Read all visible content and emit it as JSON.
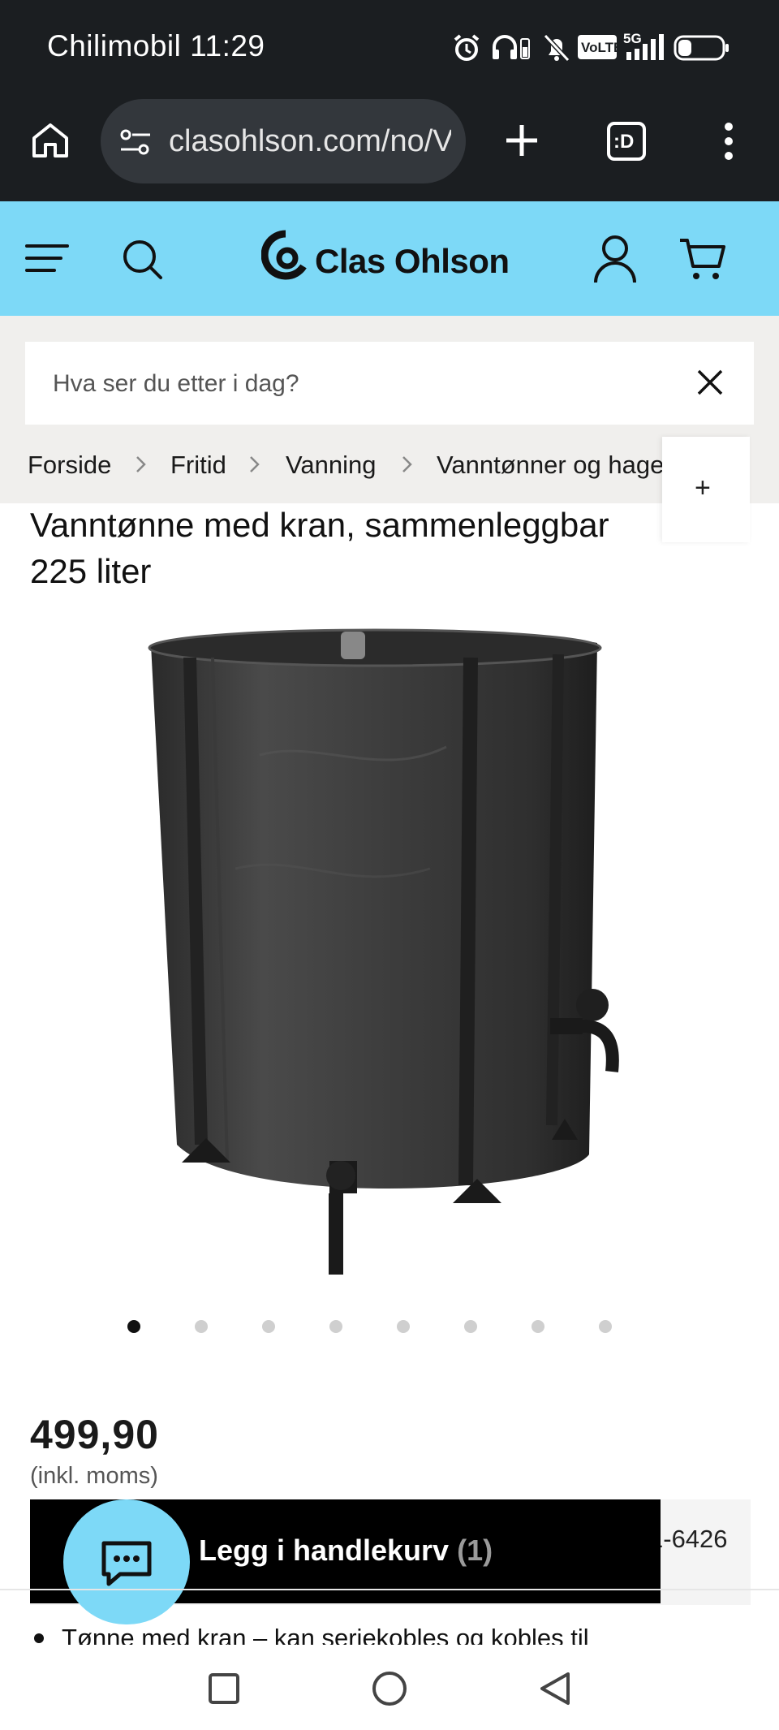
{
  "status_bar": {
    "carrier_time": "Chilimobil 11:29",
    "icons": [
      "alarm-icon",
      "headphones-icon",
      "vibrate-off-icon",
      "volte-badge",
      "signal-5g-icon",
      "battery-icon"
    ],
    "volte": "VoLTE",
    "network": "5G"
  },
  "browser": {
    "url": "clasohlson.com/no/V",
    "tab_count_label": ":D",
    "icons": [
      "home-icon",
      "site-settings-icon",
      "new-tab-plus-icon",
      "tab-switcher-icon",
      "more-menu-icon"
    ]
  },
  "site_header": {
    "brand": "Clas Ohlson",
    "accent_color": "#7dd9f7",
    "icons": [
      "menu-icon",
      "search-icon",
      "account-icon",
      "cart-icon"
    ]
  },
  "search": {
    "placeholder": "Hva ser du etter i dag?"
  },
  "breadcrumb": {
    "items": [
      "Forside",
      "Fritid",
      "Vanning",
      "Vanntønner og hageslanger"
    ],
    "expand_label": "+"
  },
  "product": {
    "title_line1": "Vanntønne med kran, sammenleggbar",
    "title_line2": "225 liter",
    "image_count": 8,
    "active_image": 1,
    "price": "499,90",
    "vat_note": "(inkl. moms)"
  },
  "cta": {
    "add_to_cart_label": "Legg i handlekurv",
    "cart_count": "(1)",
    "phone_suffix": "1-6426"
  },
  "description": {
    "bullet_1": "Tønne med kran – kan seriekobles og kobles til"
  },
  "system_nav": {
    "icons": [
      "recents-square-icon",
      "home-circle-icon",
      "back-triangle-icon"
    ]
  }
}
